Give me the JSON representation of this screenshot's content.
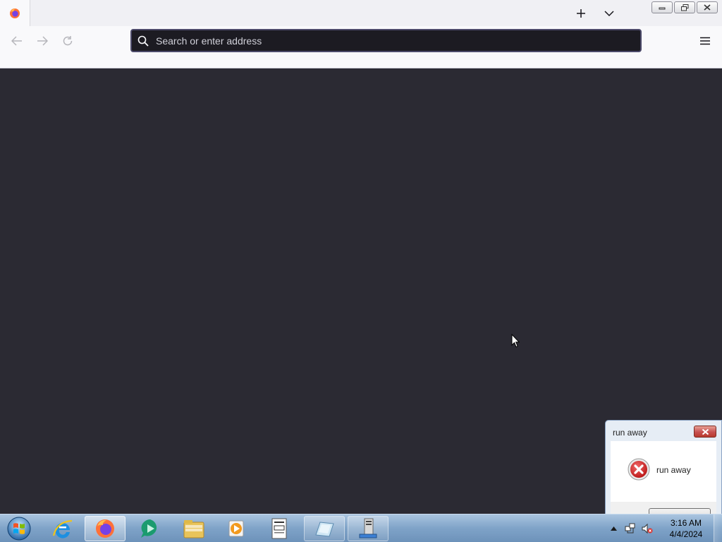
{
  "browser": {
    "url_placeholder": "Search or enter address",
    "colors": {
      "urlbar_bg": "#1c1b22",
      "content_bg": "#2b2a33",
      "chrome_bg": "#f9f9fb"
    }
  },
  "dialog": {
    "title": "run away",
    "message": "run away",
    "icon": "error-icon"
  },
  "taskbar": {
    "items": [
      {
        "name": "internet-explorer"
      },
      {
        "name": "firefox",
        "state": "active"
      },
      {
        "name": "unknown-app"
      },
      {
        "name": "file-explorer"
      },
      {
        "name": "media-player"
      },
      {
        "name": "notepad-document"
      },
      {
        "name": "dialog-app",
        "state": "open"
      },
      {
        "name": "server-app",
        "state": "open"
      }
    ],
    "clock": {
      "time": "3:16 AM",
      "date": "4/4/2024"
    }
  }
}
